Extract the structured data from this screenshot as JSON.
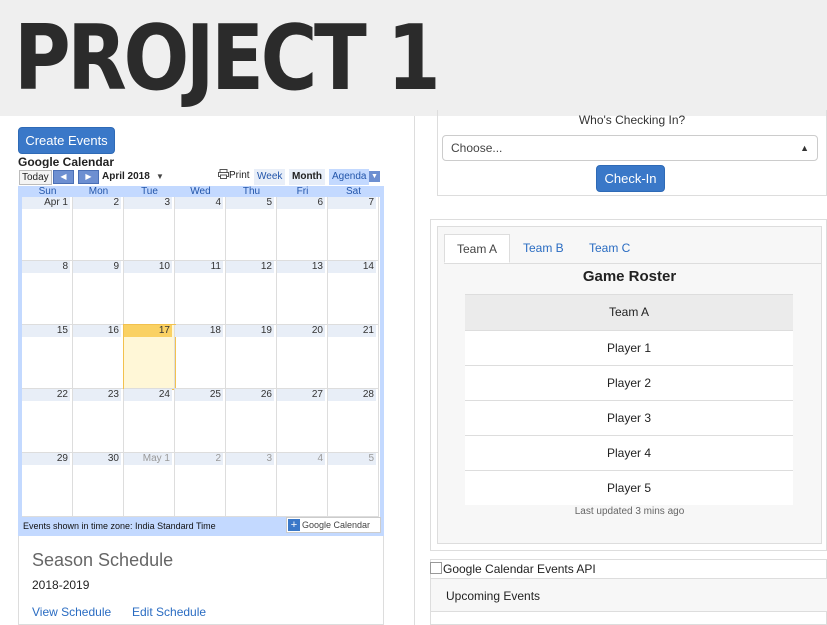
{
  "header": {
    "title": "PROJECT 1"
  },
  "left": {
    "create_events_label": "Create Events",
    "calendar_heading": "Google Calendar",
    "calendar": {
      "today_label": "Today",
      "prev_arrow": "◀",
      "next_arrow": "▶",
      "month_label": "April 2018",
      "print_label": "Print",
      "view_tabs": {
        "week": "Week",
        "month": "Month",
        "agenda": "Agenda"
      },
      "weekdays": [
        "Sun",
        "Mon",
        "Tue",
        "Wed",
        "Thu",
        "Fri",
        "Sat"
      ],
      "weeks": [
        [
          "Apr 1",
          "2",
          "3",
          "4",
          "5",
          "6",
          "7"
        ],
        [
          "8",
          "9",
          "10",
          "11",
          "12",
          "13",
          "14"
        ],
        [
          "15",
          "16",
          "17",
          "18",
          "19",
          "20",
          "21"
        ],
        [
          "22",
          "23",
          "24",
          "25",
          "26",
          "27",
          "28"
        ],
        [
          "29",
          "30",
          "May 1",
          "2",
          "3",
          "4",
          "5"
        ]
      ],
      "today_date": "17",
      "timezone_note": "Events shown in time zone: India Standard Time",
      "gcal_badge": "Google Calendar"
    },
    "season": {
      "title": "Season Schedule",
      "year": "2018-2019",
      "view_link": "View Schedule",
      "edit_link": "Edit Schedule"
    }
  },
  "right": {
    "checkin": {
      "label": "Who's Checking In?",
      "select_value": "Choose...",
      "button": "Check-In"
    },
    "roster": {
      "tabs": [
        "Team A",
        "Team B",
        "Team C"
      ],
      "active_tab": "Team A",
      "title": "Game Roster",
      "table_header": "Team A",
      "players": [
        "Player 1",
        "Player 2",
        "Player 3",
        "Player 4",
        "Player 5"
      ],
      "updated": "Last updated 3 mins ago"
    },
    "api": {
      "image_alt": "Google Calendar Events API",
      "upcoming_label": "Upcoming Events"
    }
  },
  "colors": {
    "primary": "#3a78c8",
    "today_highlight": "#fad163",
    "calendar_frame": "#c3d9ff"
  }
}
